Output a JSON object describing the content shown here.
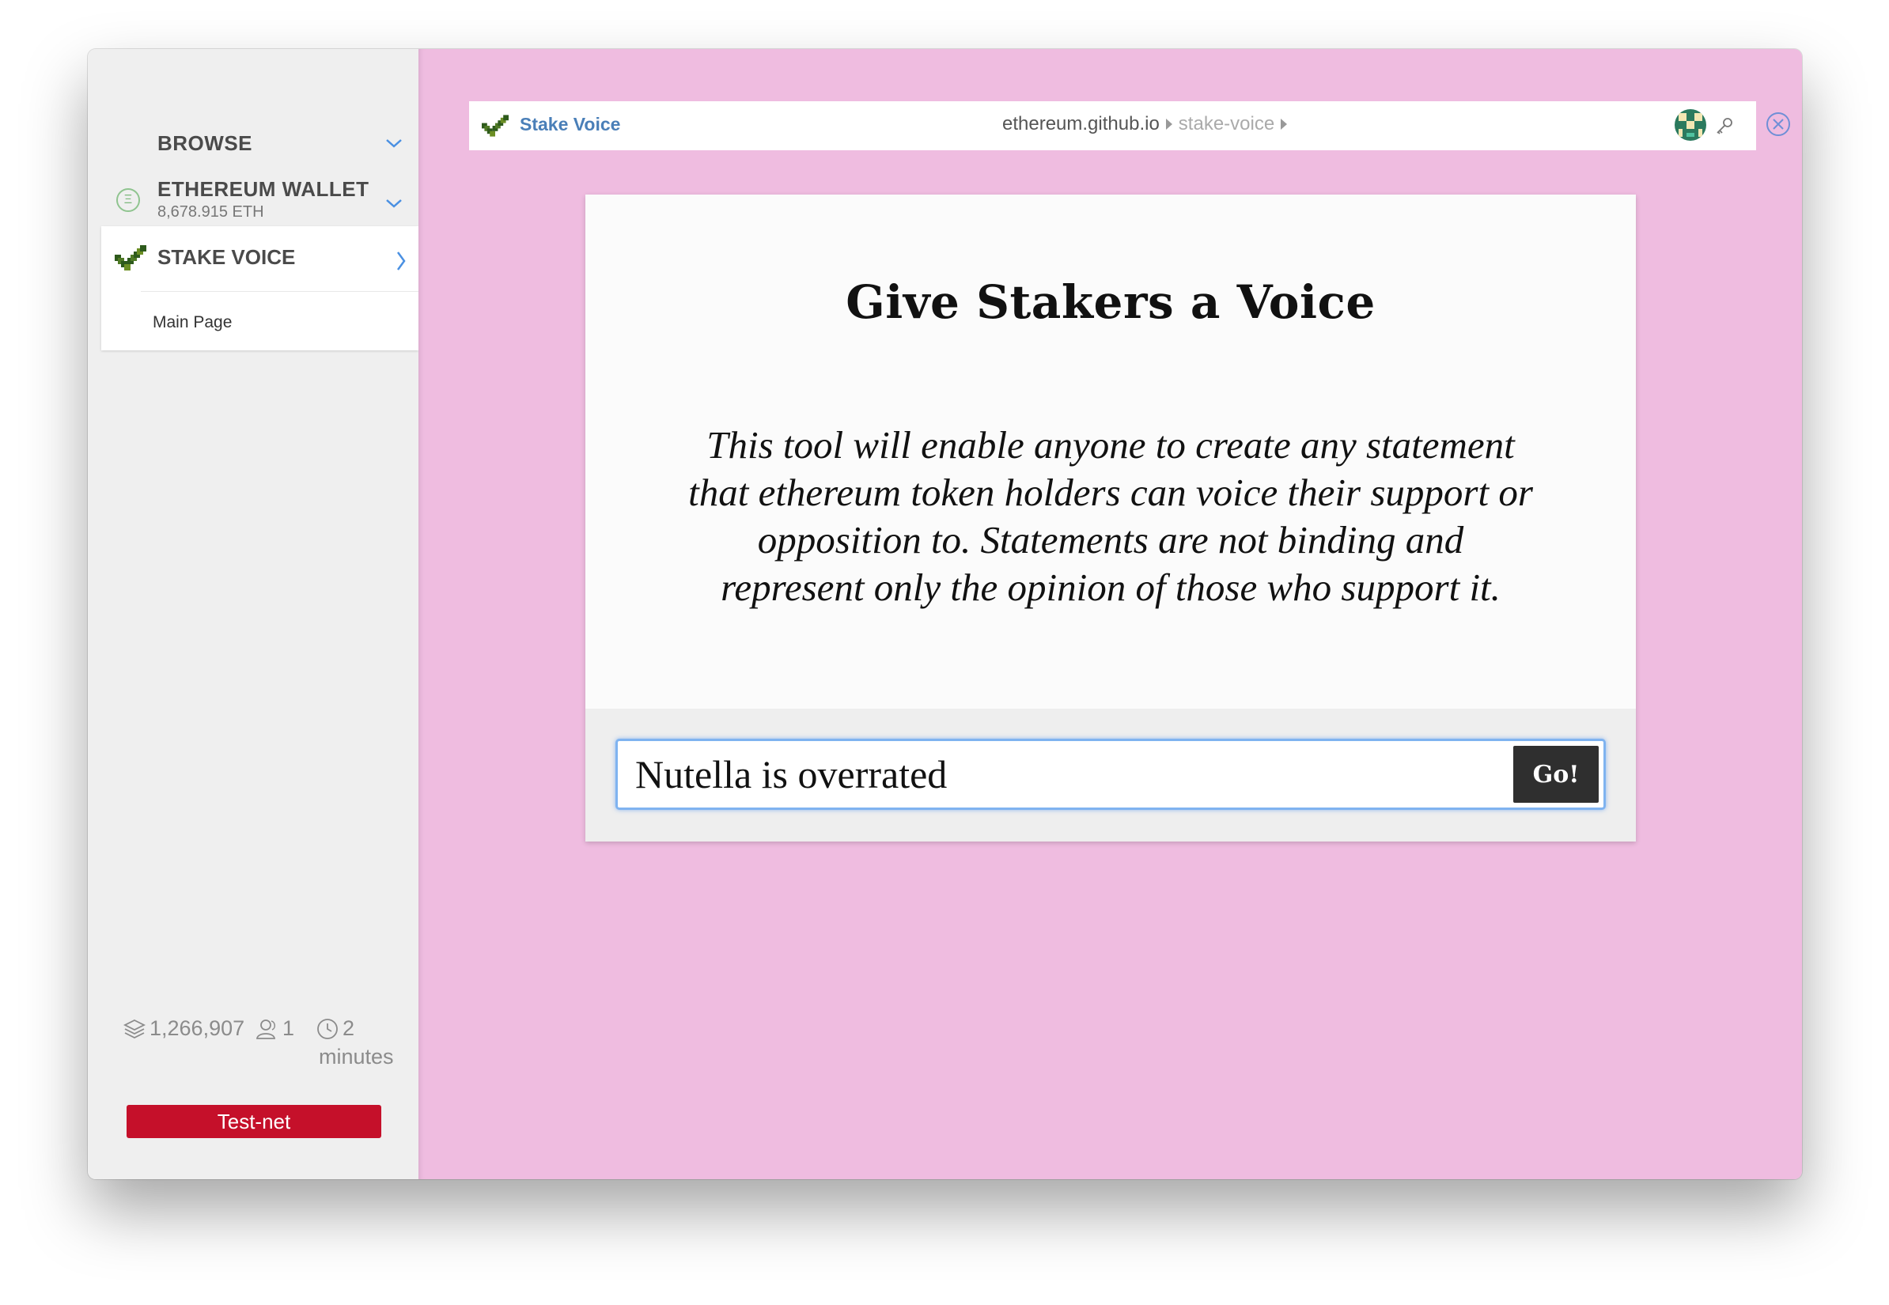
{
  "sidebar": {
    "browse_label": "BROWSE",
    "wallet_label": "ETHEREUM WALLET",
    "wallet_balance": "8,678.915 ETH",
    "active_app": "STAKE VOICE",
    "active_subpage": "Main Page",
    "stats": {
      "blocks": "1,266,907",
      "peers": "1",
      "time_value": "2",
      "time_unit": "minutes"
    },
    "network_label": "Test-net"
  },
  "browser": {
    "site_name": "Stake Voice",
    "domain": "ethereum.github.io",
    "path": "stake-voice"
  },
  "page": {
    "heading": "Give Stakers a Voice",
    "description": "This tool will enable anyone to create any statement that ethereum token holders can voice their support or opposition to. Statements are not binding and represent only the opinion of those who support it.",
    "statement_input_value": "Nutella is overrated",
    "go_button_label": "Go!"
  },
  "colors": {
    "main_background": "#efbce0",
    "sidebar_background": "#efefef",
    "accent_blue": "#4a7fb8",
    "testnet_red": "#c5102a",
    "go_button": "#2f2f2f"
  },
  "icons": [
    "chevron-down-icon",
    "ethereum-icon",
    "stake-voice-logo-icon",
    "chevron-right-icon",
    "layers-icon",
    "peers-icon",
    "clock-icon",
    "identicon-icon",
    "key-icon",
    "close-circle-icon"
  ]
}
